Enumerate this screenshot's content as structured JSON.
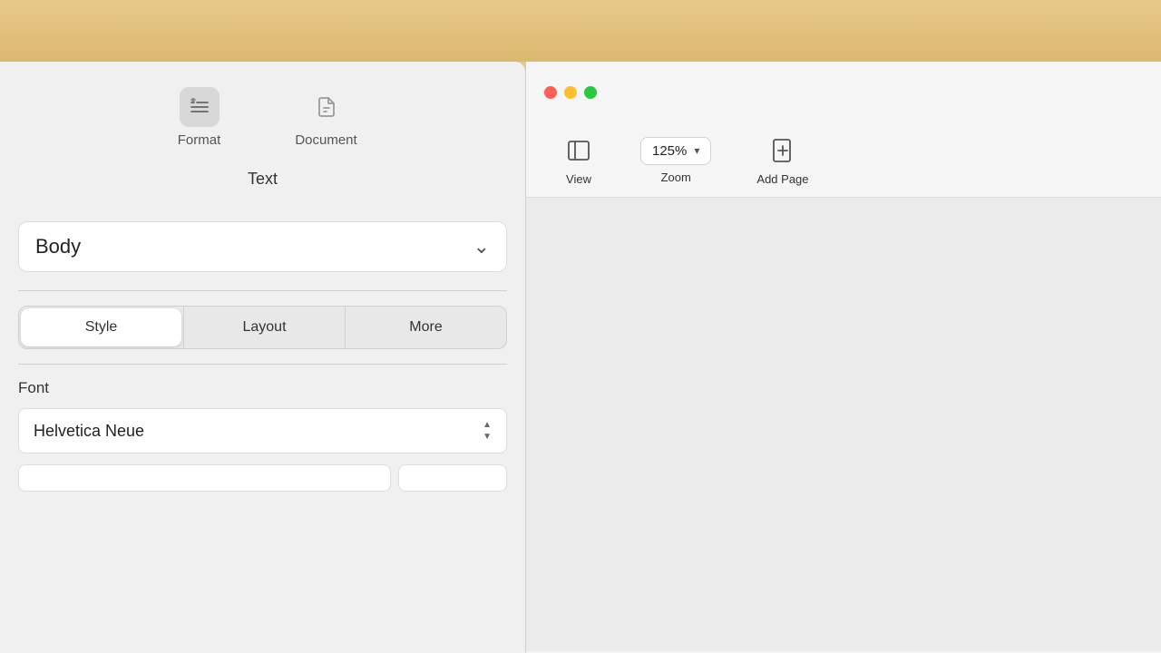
{
  "topbar": {
    "background": "#e8c98a"
  },
  "sidebar": {
    "toolbar": {
      "format_label": "Format",
      "document_label": "Document"
    },
    "text_section_label": "Text",
    "body_dropdown": {
      "label": "Body",
      "chevron": "⌄"
    },
    "tabs": [
      {
        "id": "style",
        "label": "Style",
        "active": true
      },
      {
        "id": "layout",
        "label": "Layout",
        "active": false
      },
      {
        "id": "more",
        "label": "More",
        "active": false
      }
    ],
    "font_section": {
      "label": "Font",
      "value": "Helvetica Neue"
    }
  },
  "window": {
    "toolbar": {
      "view_label": "View",
      "zoom_value": "125%",
      "zoom_label": "Zoom",
      "add_page_label": "Add Page"
    }
  }
}
